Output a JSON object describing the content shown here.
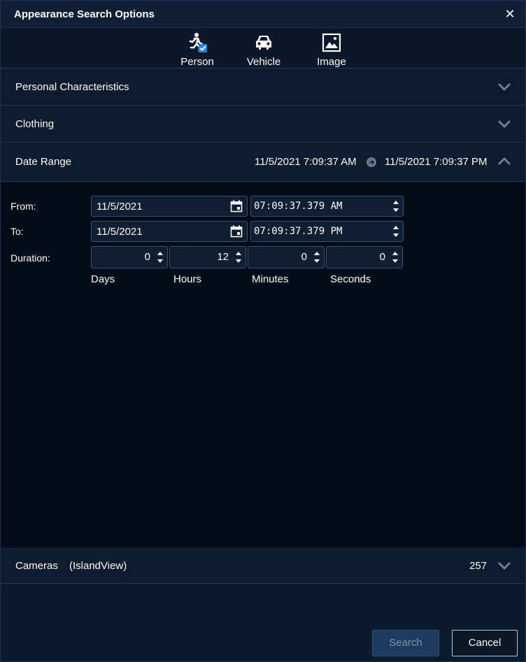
{
  "dialog": {
    "title": "Appearance Search Options",
    "close_icon": "close-icon"
  },
  "types": [
    {
      "label": "Person",
      "icon": "person-running-icon",
      "selected": true
    },
    {
      "label": "Vehicle",
      "icon": "car-icon",
      "selected": false
    },
    {
      "label": "Image",
      "icon": "image-icon",
      "selected": false
    }
  ],
  "sections": {
    "personal": {
      "label": "Personal Characteristics",
      "expanded": false
    },
    "clothing": {
      "label": "Clothing",
      "expanded": false
    },
    "date_range": {
      "label": "Date Range",
      "expanded": true,
      "summary_from": "11/5/2021 7:09:37 AM",
      "summary_to": "11/5/2021 7:09:37 PM"
    },
    "cameras": {
      "label": "Cameras",
      "site": "(IslandView)",
      "count": "257",
      "expanded": false
    }
  },
  "date_form": {
    "from_label": "From:",
    "to_label": "To:",
    "duration_label": "Duration:",
    "from_date": "11/5/2021",
    "from_time": "07:09:37.379 AM",
    "to_date": "11/5/2021",
    "to_time": "07:09:37.379 PM",
    "duration": {
      "days": "0",
      "hours": "12",
      "minutes": "0",
      "seconds": "0"
    },
    "units": {
      "days": "Days",
      "hours": "Hours",
      "minutes": "Minutes",
      "seconds": "Seconds"
    }
  },
  "footer": {
    "search_label": "Search",
    "cancel_label": "Cancel",
    "search_enabled": false
  },
  "colors": {
    "accent_check": "#1e88e5",
    "panel_bg": "#020b16",
    "header_bg": "#0c1b2e"
  }
}
